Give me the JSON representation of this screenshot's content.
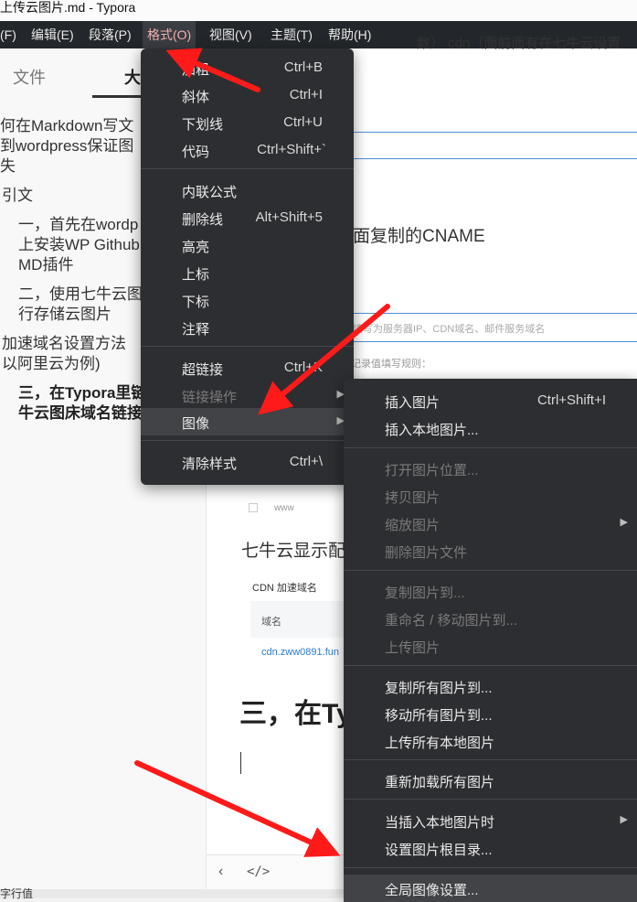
{
  "window": {
    "title": "上传云图片.md - Typora"
  },
  "menubar": {
    "items": [
      {
        "label": "(F)"
      },
      {
        "label": "编辑(E)"
      },
      {
        "label": "段落(P)"
      },
      {
        "label": "格式(O)"
      },
      {
        "label": "视图(V)"
      },
      {
        "label": "主题(T)"
      },
      {
        "label": "帮助(H)"
      }
    ],
    "overflow_text": "数）  cdn（面前面有在七牛云设置"
  },
  "sidebar": {
    "tabs": [
      {
        "label": "文件"
      },
      {
        "label": "大"
      }
    ],
    "outline": [
      "何在Markdown写文",
      "到wordpress保证图",
      "失",
      "引文",
      "一，首先在wordp",
      "上安装WP Github",
      "MD插件",
      "二，使用七牛云图",
      "行存储云图片",
      "加速域名设置方法",
      "以阿里云为例)",
      "三，在Typora里链",
      "牛云图床域名链接"
    ]
  },
  "editor": {
    "cname_text": "面复制的CNAME",
    "placeholder_text": "填写为服务器IP、CDN域名、邮件服务域名",
    "hint_text": "记录值填写规则：",
    "www": "www",
    "qiniu_text": "七牛云显示配",
    "cdn_label": "CDN 加速域名",
    "domain_label": "域名",
    "domain_value": "cdn.zww0891.fun",
    "heading": "三，在Ty"
  },
  "format_menu": {
    "items": [
      {
        "label": "加粗",
        "shortcut": "Ctrl+B"
      },
      {
        "label": "斜体",
        "shortcut": "Ctrl+I"
      },
      {
        "label": "下划线",
        "shortcut": "Ctrl+U"
      },
      {
        "label": "代码",
        "shortcut": "Ctrl+Shift+`"
      },
      {
        "label": "内联公式",
        "shortcut": ""
      },
      {
        "label": "删除线",
        "shortcut": "Alt+Shift+5"
      },
      {
        "label": "高亮",
        "shortcut": ""
      },
      {
        "label": "上标",
        "shortcut": ""
      },
      {
        "label": "下标",
        "shortcut": ""
      },
      {
        "label": "注释",
        "shortcut": ""
      },
      {
        "label": "超链接",
        "shortcut": "Ctrl+K"
      },
      {
        "label": "链接操作",
        "shortcut": ""
      },
      {
        "label": "图像",
        "shortcut": ""
      },
      {
        "label": "清除样式",
        "shortcut": "Ctrl+\\"
      }
    ]
  },
  "image_menu": {
    "items": [
      {
        "label": "插入图片",
        "shortcut": "Ctrl+Shift+I"
      },
      {
        "label": "插入本地图片..."
      },
      {
        "label": "打开图片位置..."
      },
      {
        "label": "拷贝图片"
      },
      {
        "label": "缩放图片"
      },
      {
        "label": "删除图片文件"
      },
      {
        "label": "复制图片到..."
      },
      {
        "label": "重命名 / 移动图片到..."
      },
      {
        "label": "上传图片"
      },
      {
        "label": "复制所有图片到..."
      },
      {
        "label": "移动所有图片到..."
      },
      {
        "label": "上传所有本地图片"
      },
      {
        "label": "重新加载所有图片"
      },
      {
        "label": "当插入本地图片时"
      },
      {
        "label": "设置图片根目录..."
      },
      {
        "label": "全局图像设置..."
      }
    ]
  },
  "statusbar": {
    "text": "字行值"
  },
  "colors": {
    "menu_bg": "#2d2e31",
    "menubar_bg": "#23272b",
    "arrow": "#ff1a1a"
  }
}
